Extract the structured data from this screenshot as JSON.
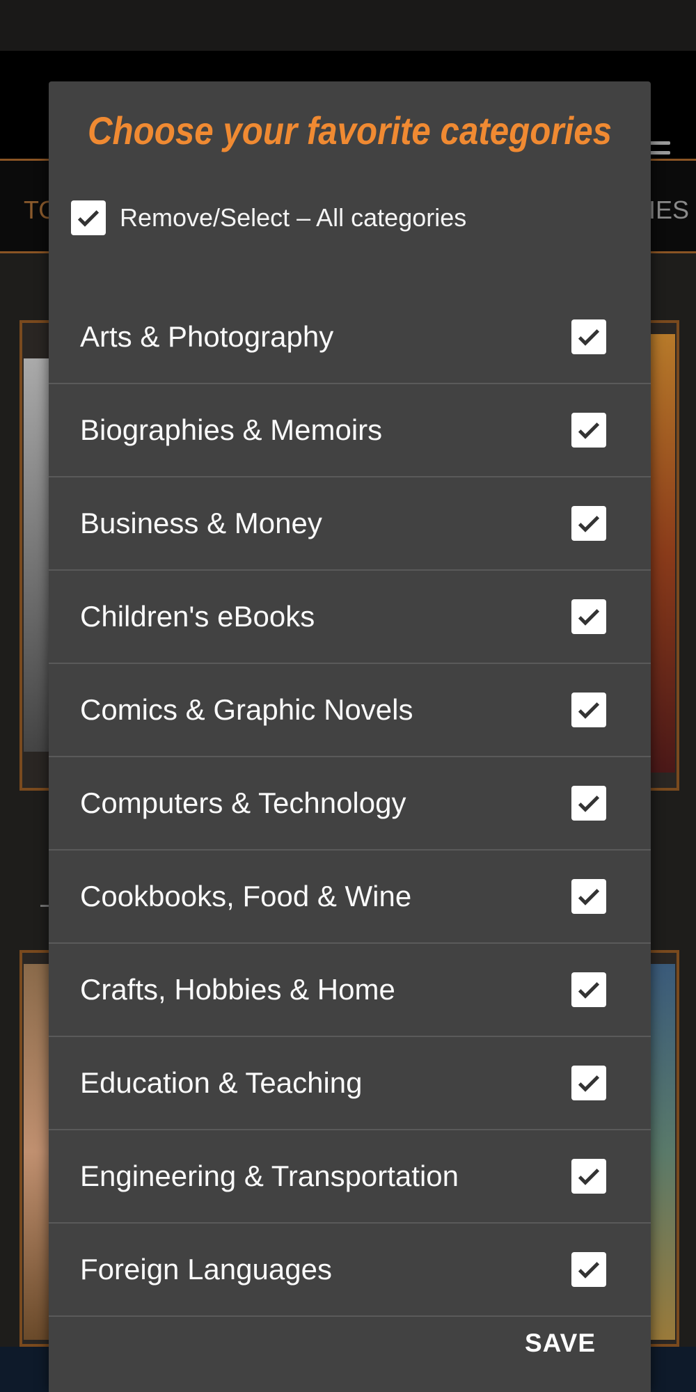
{
  "background": {
    "tab_left_partial": "TO",
    "tab_right_partial": "IES"
  },
  "dialog": {
    "title": "Choose your favorite categories",
    "select_all": {
      "label": "Remove/Select – All categories",
      "checked": true
    },
    "categories": [
      {
        "label": "Arts & Photography",
        "checked": true
      },
      {
        "label": "Biographies & Memoirs",
        "checked": true
      },
      {
        "label": "Business & Money",
        "checked": true
      },
      {
        "label": "Children's eBooks",
        "checked": true
      },
      {
        "label": "Comics & Graphic Novels",
        "checked": true
      },
      {
        "label": "Computers & Technology",
        "checked": true
      },
      {
        "label": "Cookbooks, Food & Wine",
        "checked": true
      },
      {
        "label": "Crafts, Hobbies & Home",
        "checked": true
      },
      {
        "label": "Education & Teaching",
        "checked": true
      },
      {
        "label": "Engineering & Transportation",
        "checked": true
      },
      {
        "label": "Foreign Languages",
        "checked": true
      }
    ],
    "save_label": "SAVE"
  },
  "colors": {
    "accent": "#f08a32",
    "dialog_bg": "#424242",
    "check_bg": "#ffffff"
  },
  "icons": {
    "checkbox": "checkmark-icon",
    "menu": "hamburger-menu-icon"
  }
}
